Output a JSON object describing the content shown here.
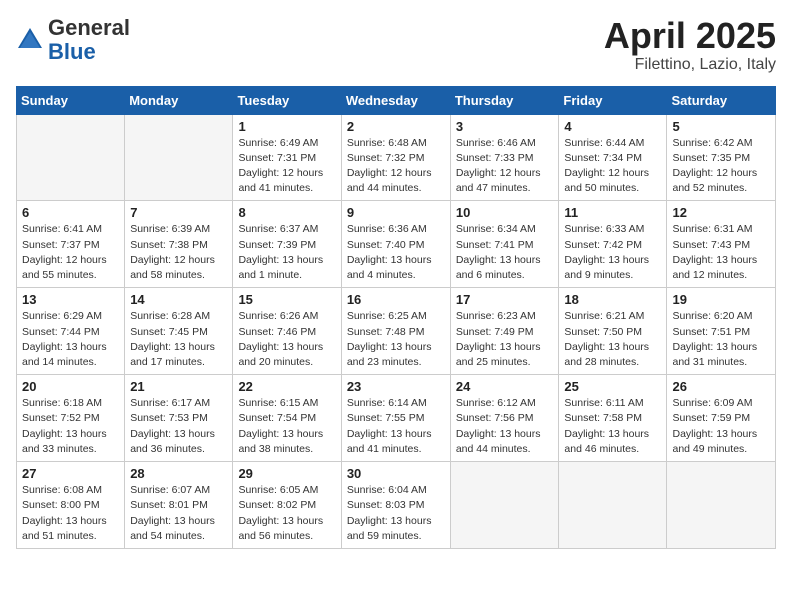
{
  "header": {
    "logo_general": "General",
    "logo_blue": "Blue",
    "month_year": "April 2025",
    "location": "Filettino, Lazio, Italy"
  },
  "weekdays": [
    "Sunday",
    "Monday",
    "Tuesday",
    "Wednesday",
    "Thursday",
    "Friday",
    "Saturday"
  ],
  "weeks": [
    [
      {
        "day": null,
        "info": null
      },
      {
        "day": null,
        "info": null
      },
      {
        "day": "1",
        "info": "Sunrise: 6:49 AM\nSunset: 7:31 PM\nDaylight: 12 hours\nand 41 minutes."
      },
      {
        "day": "2",
        "info": "Sunrise: 6:48 AM\nSunset: 7:32 PM\nDaylight: 12 hours\nand 44 minutes."
      },
      {
        "day": "3",
        "info": "Sunrise: 6:46 AM\nSunset: 7:33 PM\nDaylight: 12 hours\nand 47 minutes."
      },
      {
        "day": "4",
        "info": "Sunrise: 6:44 AM\nSunset: 7:34 PM\nDaylight: 12 hours\nand 50 minutes."
      },
      {
        "day": "5",
        "info": "Sunrise: 6:42 AM\nSunset: 7:35 PM\nDaylight: 12 hours\nand 52 minutes."
      }
    ],
    [
      {
        "day": "6",
        "info": "Sunrise: 6:41 AM\nSunset: 7:37 PM\nDaylight: 12 hours\nand 55 minutes."
      },
      {
        "day": "7",
        "info": "Sunrise: 6:39 AM\nSunset: 7:38 PM\nDaylight: 12 hours\nand 58 minutes."
      },
      {
        "day": "8",
        "info": "Sunrise: 6:37 AM\nSunset: 7:39 PM\nDaylight: 13 hours\nand 1 minute."
      },
      {
        "day": "9",
        "info": "Sunrise: 6:36 AM\nSunset: 7:40 PM\nDaylight: 13 hours\nand 4 minutes."
      },
      {
        "day": "10",
        "info": "Sunrise: 6:34 AM\nSunset: 7:41 PM\nDaylight: 13 hours\nand 6 minutes."
      },
      {
        "day": "11",
        "info": "Sunrise: 6:33 AM\nSunset: 7:42 PM\nDaylight: 13 hours\nand 9 minutes."
      },
      {
        "day": "12",
        "info": "Sunrise: 6:31 AM\nSunset: 7:43 PM\nDaylight: 13 hours\nand 12 minutes."
      }
    ],
    [
      {
        "day": "13",
        "info": "Sunrise: 6:29 AM\nSunset: 7:44 PM\nDaylight: 13 hours\nand 14 minutes."
      },
      {
        "day": "14",
        "info": "Sunrise: 6:28 AM\nSunset: 7:45 PM\nDaylight: 13 hours\nand 17 minutes."
      },
      {
        "day": "15",
        "info": "Sunrise: 6:26 AM\nSunset: 7:46 PM\nDaylight: 13 hours\nand 20 minutes."
      },
      {
        "day": "16",
        "info": "Sunrise: 6:25 AM\nSunset: 7:48 PM\nDaylight: 13 hours\nand 23 minutes."
      },
      {
        "day": "17",
        "info": "Sunrise: 6:23 AM\nSunset: 7:49 PM\nDaylight: 13 hours\nand 25 minutes."
      },
      {
        "day": "18",
        "info": "Sunrise: 6:21 AM\nSunset: 7:50 PM\nDaylight: 13 hours\nand 28 minutes."
      },
      {
        "day": "19",
        "info": "Sunrise: 6:20 AM\nSunset: 7:51 PM\nDaylight: 13 hours\nand 31 minutes."
      }
    ],
    [
      {
        "day": "20",
        "info": "Sunrise: 6:18 AM\nSunset: 7:52 PM\nDaylight: 13 hours\nand 33 minutes."
      },
      {
        "day": "21",
        "info": "Sunrise: 6:17 AM\nSunset: 7:53 PM\nDaylight: 13 hours\nand 36 minutes."
      },
      {
        "day": "22",
        "info": "Sunrise: 6:15 AM\nSunset: 7:54 PM\nDaylight: 13 hours\nand 38 minutes."
      },
      {
        "day": "23",
        "info": "Sunrise: 6:14 AM\nSunset: 7:55 PM\nDaylight: 13 hours\nand 41 minutes."
      },
      {
        "day": "24",
        "info": "Sunrise: 6:12 AM\nSunset: 7:56 PM\nDaylight: 13 hours\nand 44 minutes."
      },
      {
        "day": "25",
        "info": "Sunrise: 6:11 AM\nSunset: 7:58 PM\nDaylight: 13 hours\nand 46 minutes."
      },
      {
        "day": "26",
        "info": "Sunrise: 6:09 AM\nSunset: 7:59 PM\nDaylight: 13 hours\nand 49 minutes."
      }
    ],
    [
      {
        "day": "27",
        "info": "Sunrise: 6:08 AM\nSunset: 8:00 PM\nDaylight: 13 hours\nand 51 minutes."
      },
      {
        "day": "28",
        "info": "Sunrise: 6:07 AM\nSunset: 8:01 PM\nDaylight: 13 hours\nand 54 minutes."
      },
      {
        "day": "29",
        "info": "Sunrise: 6:05 AM\nSunset: 8:02 PM\nDaylight: 13 hours\nand 56 minutes."
      },
      {
        "day": "30",
        "info": "Sunrise: 6:04 AM\nSunset: 8:03 PM\nDaylight: 13 hours\nand 59 minutes."
      },
      {
        "day": null,
        "info": null
      },
      {
        "day": null,
        "info": null
      },
      {
        "day": null,
        "info": null
      }
    ]
  ]
}
